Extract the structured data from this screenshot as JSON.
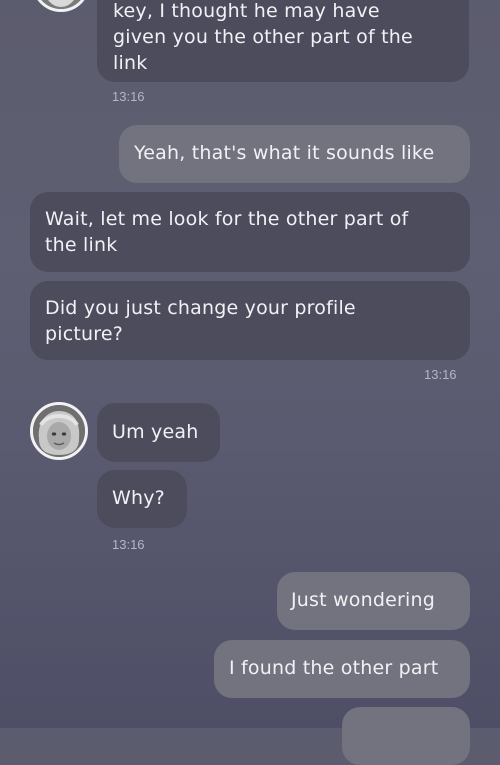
{
  "messages": [
    {
      "id": "m1",
      "direction": "incoming",
      "text": "key, I thought he may have\ngiven you the other part of the\nlink"
    },
    {
      "id": "m2",
      "direction": "outgoing",
      "text": "Yeah, that's what it sounds like"
    },
    {
      "id": "m3",
      "direction": "incoming",
      "text": "Wait, let me look for the other part of\nthe link"
    },
    {
      "id": "m4",
      "direction": "incoming",
      "text": "Did you just change your profile\npicture?"
    },
    {
      "id": "m5",
      "direction": "incoming",
      "text": "Um yeah"
    },
    {
      "id": "m6",
      "direction": "incoming",
      "text": "Why?"
    },
    {
      "id": "m7",
      "direction": "outgoing",
      "text": "Just wondering"
    },
    {
      "id": "m8",
      "direction": "outgoing",
      "text": "I found the other part"
    }
  ],
  "timestamps": {
    "t1": "13:16",
    "t2": "13:16",
    "t3": "13:16"
  },
  "colors": {
    "incoming_bubble": "#4c4c5d",
    "outgoing_bubble": "#72737f",
    "text": "#f1f1f5",
    "timestamp": "#b4b6c6"
  },
  "avatar": {
    "icon": "user-avatar-photo"
  }
}
